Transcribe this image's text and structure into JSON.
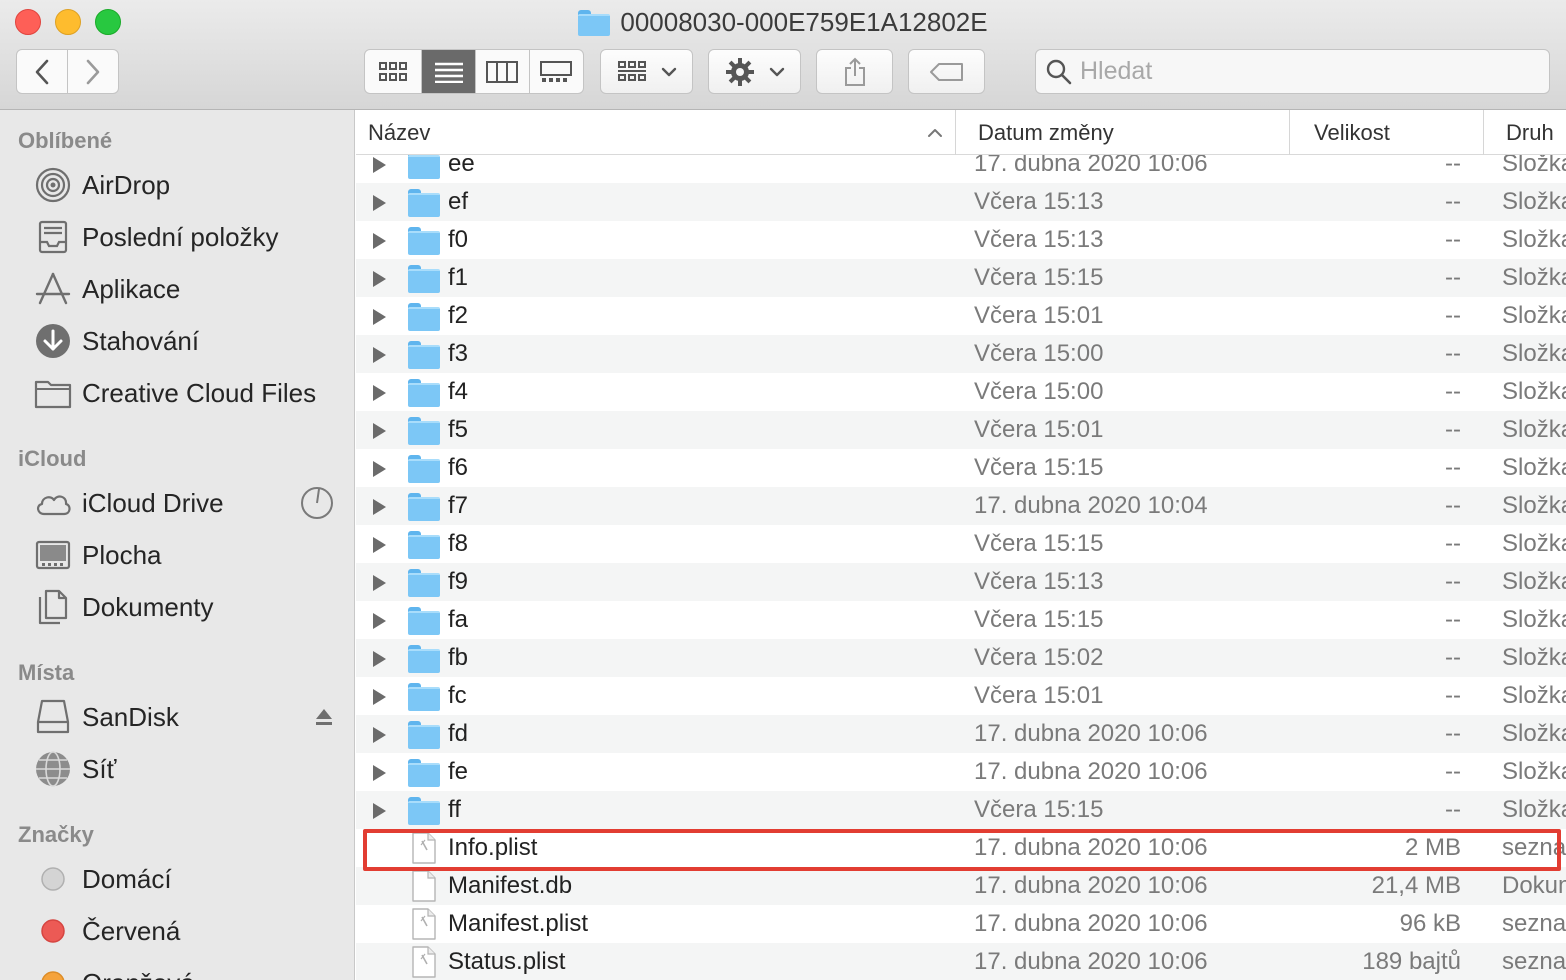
{
  "window": {
    "title": "00008030-000E759E1A12802E"
  },
  "search": {
    "placeholder": "Hledat"
  },
  "sidebar": {
    "favorites_title": "Oblíbené",
    "favorites": [
      {
        "label": "AirDrop",
        "icon": "airdrop-icon"
      },
      {
        "label": "Poslední položky",
        "icon": "recents-icon"
      },
      {
        "label": "Aplikace",
        "icon": "applications-icon"
      },
      {
        "label": "Stahování",
        "icon": "downloads-icon"
      },
      {
        "label": "Creative Cloud Files",
        "icon": "folder-icon"
      }
    ],
    "icloud_title": "iCloud",
    "icloud": [
      {
        "label": "iCloud Drive",
        "icon": "cloud-icon"
      },
      {
        "label": "Plocha",
        "icon": "desktop-icon"
      },
      {
        "label": "Dokumenty",
        "icon": "documents-icon"
      }
    ],
    "places_title": "Místa",
    "places": [
      {
        "label": "SanDisk",
        "icon": "drive-icon"
      },
      {
        "label": "Síť",
        "icon": "network-icon"
      }
    ],
    "tags_title": "Značky",
    "tags": [
      {
        "label": "Domácí",
        "color": "#c8c8c8"
      },
      {
        "label": "Červená",
        "color": "#ec5a55"
      },
      {
        "label": "Oranžová",
        "color": "#f5a33c"
      }
    ]
  },
  "columns": {
    "name": "Název",
    "date": "Datum změny",
    "size": "Velikost",
    "kind": "Druh"
  },
  "rows": [
    {
      "name": "ee",
      "date": "17. dubna 2020 10:06",
      "size": "--",
      "kind": "Složka",
      "type": "folder"
    },
    {
      "name": "ef",
      "date": "Včera 15:13",
      "size": "--",
      "kind": "Složka",
      "type": "folder"
    },
    {
      "name": "f0",
      "date": "Včera 15:13",
      "size": "--",
      "kind": "Složka",
      "type": "folder"
    },
    {
      "name": "f1",
      "date": "Včera 15:15",
      "size": "--",
      "kind": "Složka",
      "type": "folder"
    },
    {
      "name": "f2",
      "date": "Včera 15:01",
      "size": "--",
      "kind": "Složka",
      "type": "folder"
    },
    {
      "name": "f3",
      "date": "Včera 15:00",
      "size": "--",
      "kind": "Složka",
      "type": "folder"
    },
    {
      "name": "f4",
      "date": "Včera 15:00",
      "size": "--",
      "kind": "Složka",
      "type": "folder"
    },
    {
      "name": "f5",
      "date": "Včera 15:01",
      "size": "--",
      "kind": "Složka",
      "type": "folder"
    },
    {
      "name": "f6",
      "date": "Včera 15:15",
      "size": "--",
      "kind": "Složka",
      "type": "folder"
    },
    {
      "name": "f7",
      "date": "17. dubna 2020 10:04",
      "size": "--",
      "kind": "Složka",
      "type": "folder"
    },
    {
      "name": "f8",
      "date": "Včera 15:15",
      "size": "--",
      "kind": "Složka",
      "type": "folder"
    },
    {
      "name": "f9",
      "date": "Včera 15:13",
      "size": "--",
      "kind": "Složka",
      "type": "folder"
    },
    {
      "name": "fa",
      "date": "Včera 15:15",
      "size": "--",
      "kind": "Složka",
      "type": "folder"
    },
    {
      "name": "fb",
      "date": "Včera 15:02",
      "size": "--",
      "kind": "Složka",
      "type": "folder"
    },
    {
      "name": "fc",
      "date": "Včera 15:01",
      "size": "--",
      "kind": "Složka",
      "type": "folder"
    },
    {
      "name": "fd",
      "date": "17. dubna 2020 10:06",
      "size": "--",
      "kind": "Složka",
      "type": "folder"
    },
    {
      "name": "fe",
      "date": "17. dubna 2020 10:06",
      "size": "--",
      "kind": "Složka",
      "type": "folder"
    },
    {
      "name": "ff",
      "date": "Včera 15:15",
      "size": "--",
      "kind": "Složka",
      "type": "folder"
    },
    {
      "name": "Info.plist",
      "date": "17. dubna 2020 10:06",
      "size": "2 MB",
      "kind": "seznam",
      "type": "plist"
    },
    {
      "name": "Manifest.db",
      "date": "17. dubna 2020 10:06",
      "size": "21,4 MB",
      "kind": "Dokument",
      "type": "doc"
    },
    {
      "name": "Manifest.plist",
      "date": "17. dubna 2020 10:06",
      "size": "96 kB",
      "kind": "seznam",
      "type": "plist"
    },
    {
      "name": "Status.plist",
      "date": "17. dubna 2020 10:06",
      "size": "189 bajtů",
      "kind": "seznam",
      "type": "plist"
    }
  ],
  "colors": {
    "highlight": "#e23d32",
    "folder": "#7cc7f6"
  }
}
